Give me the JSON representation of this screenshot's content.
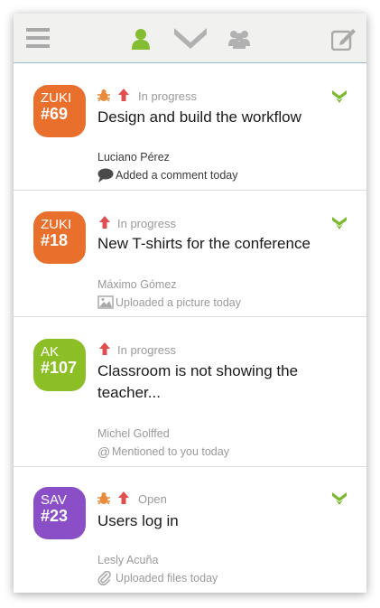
{
  "topbar": {
    "menu_icon": "hamburger-menu-icon",
    "user_icon": "person-icon",
    "filter_icon": "chevron-filter-icon",
    "team_icon": "group-icon",
    "compose_icon": "compose-icon"
  },
  "colors": {
    "orange": "#e86f2c",
    "green": "#8cbf26",
    "purple": "#8a4fc7",
    "accent_green": "#7cb82f",
    "priority_red": "#e04e4e",
    "bug_orange": "#e98b3a"
  },
  "issues": [
    {
      "project": "ZUKI",
      "number": "#69",
      "status": "In progress",
      "title_lines": [
        "Design and build the workflow"
      ],
      "user": "Luciano Pérez",
      "activity": "Added a comment today",
      "activity_icon": "speech-bubble-icon",
      "has_bug": true,
      "has_chevron": true
    },
    {
      "project": "ZUKI",
      "number": "#18",
      "status": "In progress",
      "title_lines": [
        "New T-shirts for the conference"
      ],
      "user": "Máximo Gómez",
      "activity": "Uploaded a picture today",
      "activity_icon": "picture-icon",
      "has_bug": false,
      "has_chevron": true
    },
    {
      "project": "AK",
      "number": "#107",
      "status": "In progress",
      "title_lines": [
        "Classroom is not showing the",
        "teacher..."
      ],
      "user": "Michel Golffed",
      "activity": "Mentioned to you today",
      "activity_icon": "at-sign-icon",
      "has_bug": false,
      "has_chevron": false
    },
    {
      "project": "SAV",
      "number": "#23",
      "status": "Open",
      "title_lines": [
        "Users log in"
      ],
      "user": "Lesly Acuña",
      "activity": "Uploaded files today",
      "activity_icon": "paperclip-icon",
      "has_bug": true,
      "has_chevron": true
    }
  ]
}
